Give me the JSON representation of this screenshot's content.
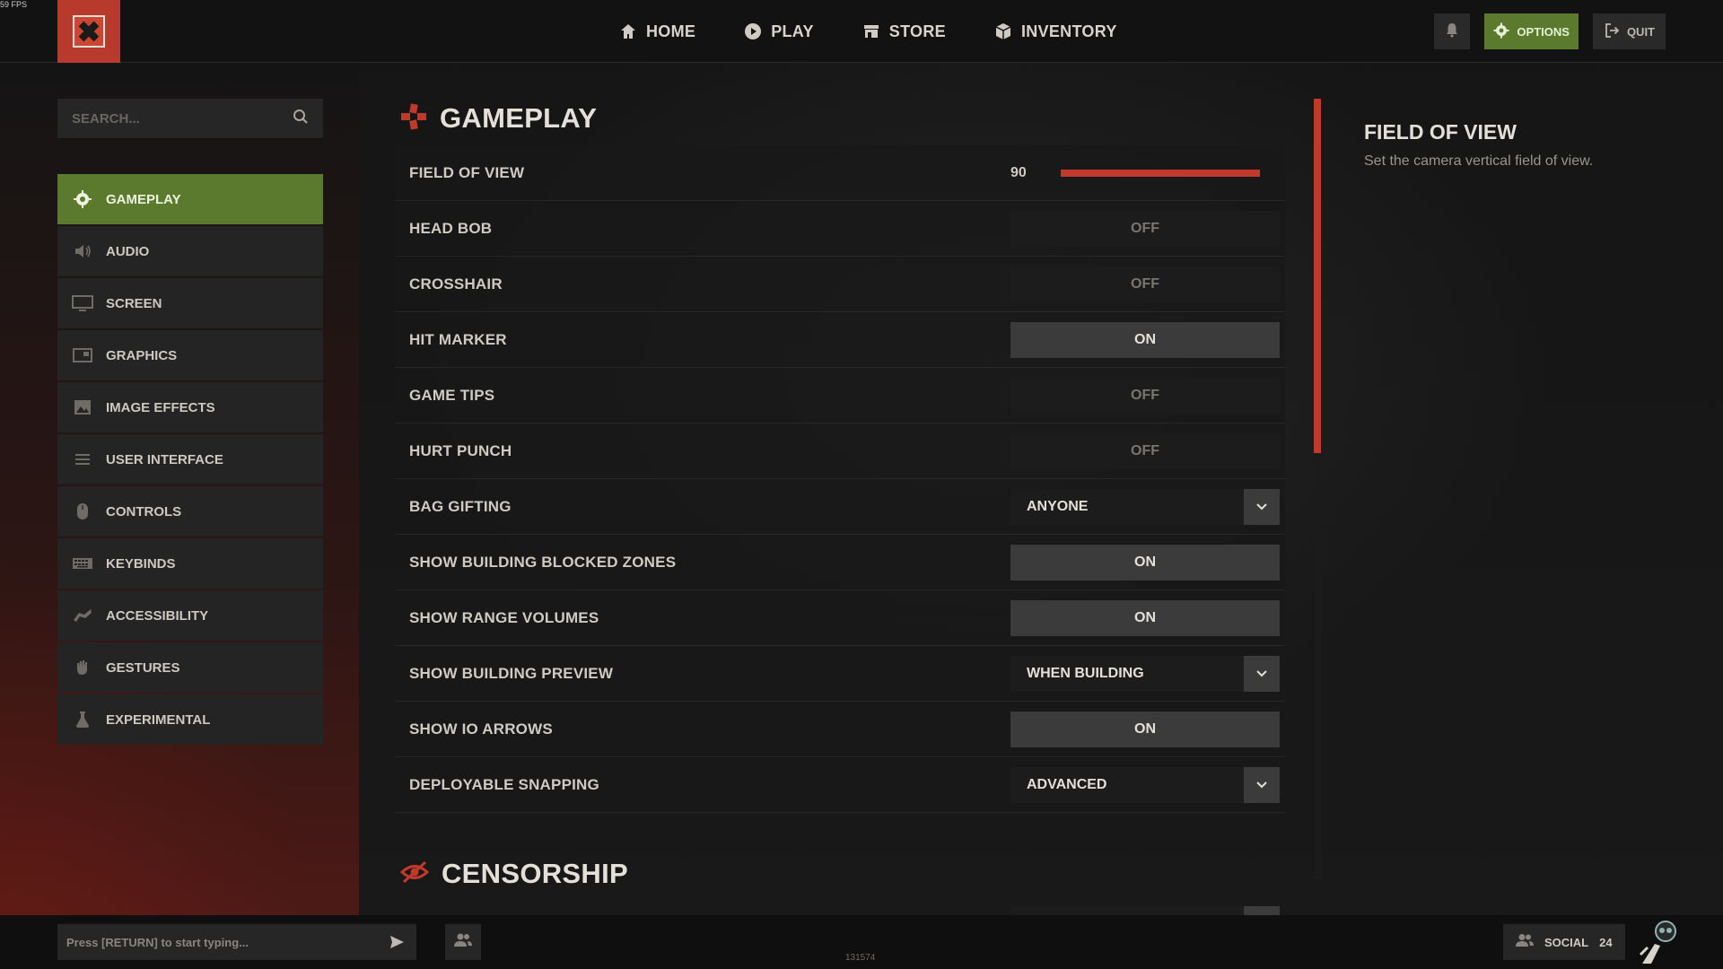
{
  "fps": "59 FPS",
  "nav": {
    "items": [
      {
        "label": "HOME",
        "icon": "home-icon"
      },
      {
        "label": "PLAY",
        "icon": "play-icon"
      },
      {
        "label": "STORE",
        "icon": "store-icon"
      },
      {
        "label": "INVENTORY",
        "icon": "inventory-icon"
      }
    ],
    "options_label": "OPTIONS",
    "quit_label": "QUIT"
  },
  "search": {
    "placeholder": "SEARCH..."
  },
  "sidebar": {
    "active": "GAMEPLAY",
    "items": [
      {
        "label": "GAMEPLAY",
        "icon": "gear-icon"
      },
      {
        "label": "AUDIO",
        "icon": "speaker-icon"
      },
      {
        "label": "SCREEN",
        "icon": "monitor-icon"
      },
      {
        "label": "GRAPHICS",
        "icon": "graphics-icon"
      },
      {
        "label": "IMAGE EFFECTS",
        "icon": "image-icon"
      },
      {
        "label": "USER INTERFACE",
        "icon": "lines-icon"
      },
      {
        "label": "CONTROLS",
        "icon": "mouse-icon"
      },
      {
        "label": "KEYBINDS",
        "icon": "keyboard-icon"
      },
      {
        "label": "ACCESSIBILITY",
        "icon": "accessibility-icon"
      },
      {
        "label": "GESTURES",
        "icon": "hand-icon"
      },
      {
        "label": "EXPERIMENTAL",
        "icon": "flask-icon"
      }
    ]
  },
  "main": {
    "section_title": "GAMEPLAY",
    "field_of_view": {
      "label": "FIELD OF VIEW",
      "value": "90",
      "fill_percent": 100
    },
    "settings": [
      {
        "label": "HEAD BOB",
        "type": "toggle",
        "value": "OFF"
      },
      {
        "label": "CROSSHAIR",
        "type": "toggle",
        "value": "OFF"
      },
      {
        "label": "HIT MARKER",
        "type": "toggle",
        "value": "ON"
      },
      {
        "label": "GAME TIPS",
        "type": "toggle",
        "value": "OFF"
      },
      {
        "label": "HURT PUNCH",
        "type": "toggle",
        "value": "OFF"
      },
      {
        "label": "BAG GIFTING",
        "type": "dropdown",
        "value": "ANYONE"
      },
      {
        "label": "SHOW BUILDING BLOCKED ZONES",
        "type": "toggle",
        "value": "ON"
      },
      {
        "label": "SHOW RANGE VOLUMES",
        "type": "toggle",
        "value": "ON"
      },
      {
        "label": "SHOW BUILDING PREVIEW",
        "type": "dropdown",
        "value": "WHEN BUILDING"
      },
      {
        "label": "SHOW IO ARROWS",
        "type": "toggle",
        "value": "ON"
      },
      {
        "label": "DEPLOYABLE SNAPPING",
        "type": "dropdown",
        "value": "ADVANCED"
      }
    ],
    "censorship_title": "CENSORSHIP"
  },
  "info": {
    "title": "FIELD OF VIEW",
    "description": "Set the camera vertical field of view."
  },
  "bottom": {
    "chat_placeholder": "Press [RETURN] to start typing...",
    "build": "131574",
    "social_label": "SOCIAL",
    "social_count": "24"
  },
  "colors": {
    "accent_red": "#c0392b",
    "active_green": "#5c7a2e",
    "logo_red": "#b83a2c"
  }
}
